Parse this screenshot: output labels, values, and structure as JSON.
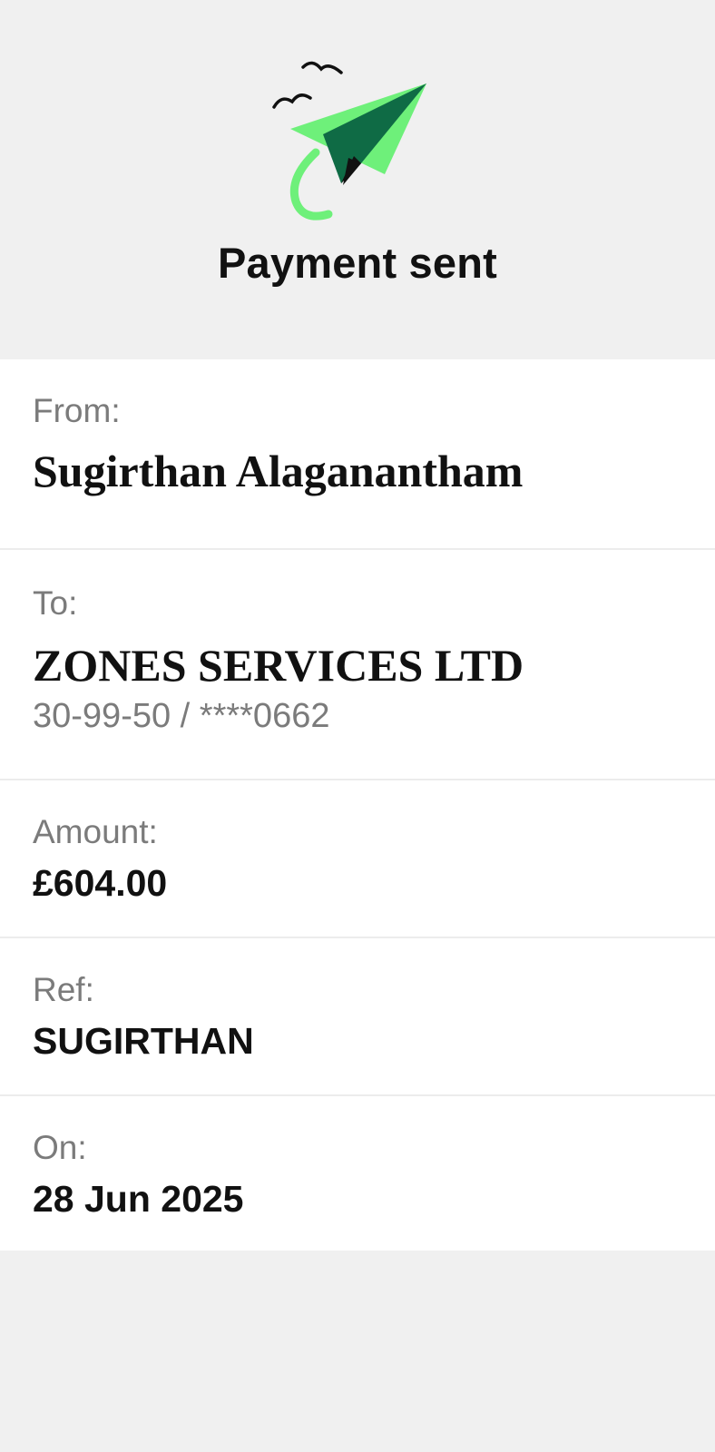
{
  "header": {
    "title": "Payment sent",
    "illustration": "paper-plane-with-birds"
  },
  "details": {
    "from": {
      "label": "From:",
      "value": "Sugirthan Alaganantham"
    },
    "to": {
      "label": "To:",
      "value": "ZONES SERVICES LTD",
      "account": "30-99-50 / ****0662"
    },
    "amount": {
      "label": "Amount:",
      "value": "£604.00"
    },
    "ref": {
      "label": "Ref:",
      "value": "SUGIRTHAN"
    },
    "on": {
      "label": "On:",
      "value": "28 Jun 2025"
    }
  },
  "colors": {
    "accent_green": "#6ef07a",
    "dark_green": "#0f6b45",
    "background": "#f0f0f0"
  }
}
